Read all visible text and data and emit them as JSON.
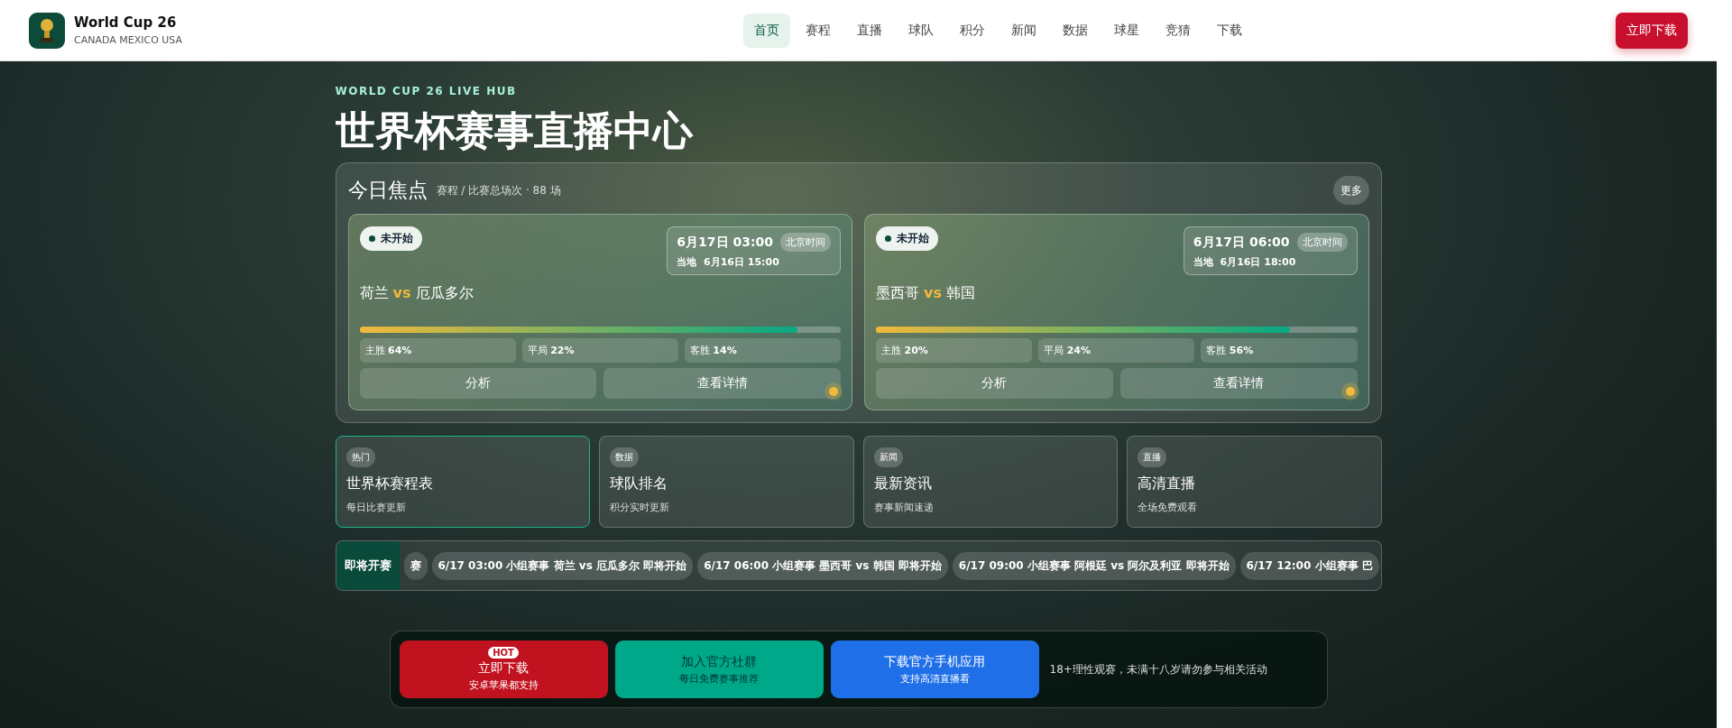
{
  "header": {
    "brand": "World Cup 26",
    "tagline": "CANADA MEXICO USA",
    "nav": [
      {
        "label": "首页",
        "selected": true
      },
      {
        "label": "赛程",
        "selected": false
      },
      {
        "label": "直播",
        "selected": false
      },
      {
        "label": "球队",
        "selected": false
      },
      {
        "label": "积分",
        "selected": false
      },
      {
        "label": "新闻",
        "selected": false
      },
      {
        "label": "数据",
        "selected": false
      },
      {
        "label": "球星",
        "selected": false
      },
      {
        "label": "竞猜",
        "selected": false
      },
      {
        "label": "下载",
        "selected": false
      }
    ],
    "cta": "立即下载"
  },
  "hero": {
    "eyebrow": "WORLD CUP 26 LIVE HUB",
    "title": "世界杯赛事直播中心"
  },
  "focus": {
    "title": "今日焦点",
    "subtitle": "赛程 / 比赛总场次 · 88 场",
    "more": "更多",
    "matches": [
      {
        "status": "未开始",
        "time": "6月17日 03:00",
        "zone": "北京时间",
        "local_label": "当地",
        "local_time": "6月16日 15:00",
        "home": "荷兰",
        "vs": "vs",
        "away": "厄瓜多尔",
        "level": 0.91,
        "odds": [
          {
            "label": "主胜",
            "value": "64%"
          },
          {
            "label": "平局",
            "value": "22%"
          },
          {
            "label": "客胜",
            "value": "14%"
          }
        ],
        "buttons": [
          "分析",
          "查看详情"
        ]
      },
      {
        "status": "未开始",
        "time": "6月17日 06:00",
        "zone": "北京时间",
        "local_label": "当地",
        "local_time": "6月16日 18:00",
        "home": "墨西哥",
        "vs": "vs",
        "away": "韩国",
        "level": 0.86,
        "odds": [
          {
            "label": "主胜",
            "value": "20%"
          },
          {
            "label": "平局",
            "value": "24%"
          },
          {
            "label": "客胜",
            "value": "56%"
          }
        ],
        "buttons": [
          "分析",
          "查看详情"
        ]
      }
    ]
  },
  "features": [
    {
      "tag": "热门",
      "title": "世界杯赛程表",
      "desc": "每日比赛更新",
      "selected": true
    },
    {
      "tag": "数据",
      "title": "球队排名",
      "desc": "积分实时更新",
      "selected": false
    },
    {
      "tag": "新闻",
      "title": "最新资讯",
      "desc": "赛事新闻速递",
      "selected": false
    },
    {
      "tag": "直播",
      "title": "高清直播",
      "desc": "全场免费观看",
      "selected": false
    }
  ],
  "ticker": {
    "label": "即将开赛",
    "items": [
      "赛",
      "6/17 03:00 小组赛事 荷兰 vs 厄瓜多尔 即将开始",
      "6/17 06:00 小组赛事 墨西哥 vs 韩国 即将开始",
      "6/17 09:00 小组赛事 阿根廷 vs 阿尔及利亚 即将开始",
      "6/17 12:00 小组赛事 巴"
    ]
  },
  "promo": {
    "buttons": [
      {
        "kind": "red",
        "badge": "HOT",
        "title": "立即下载",
        "sub": "安卓苹果都支持"
      },
      {
        "kind": "green",
        "title": "加入官方社群",
        "sub": "每日免费赛事推荐"
      },
      {
        "kind": "blue",
        "title": "下载官方手机应用",
        "sub": "支持高清直播看"
      }
    ],
    "note": "18+理性观赛，未满十八岁请勿参与相关活动"
  }
}
